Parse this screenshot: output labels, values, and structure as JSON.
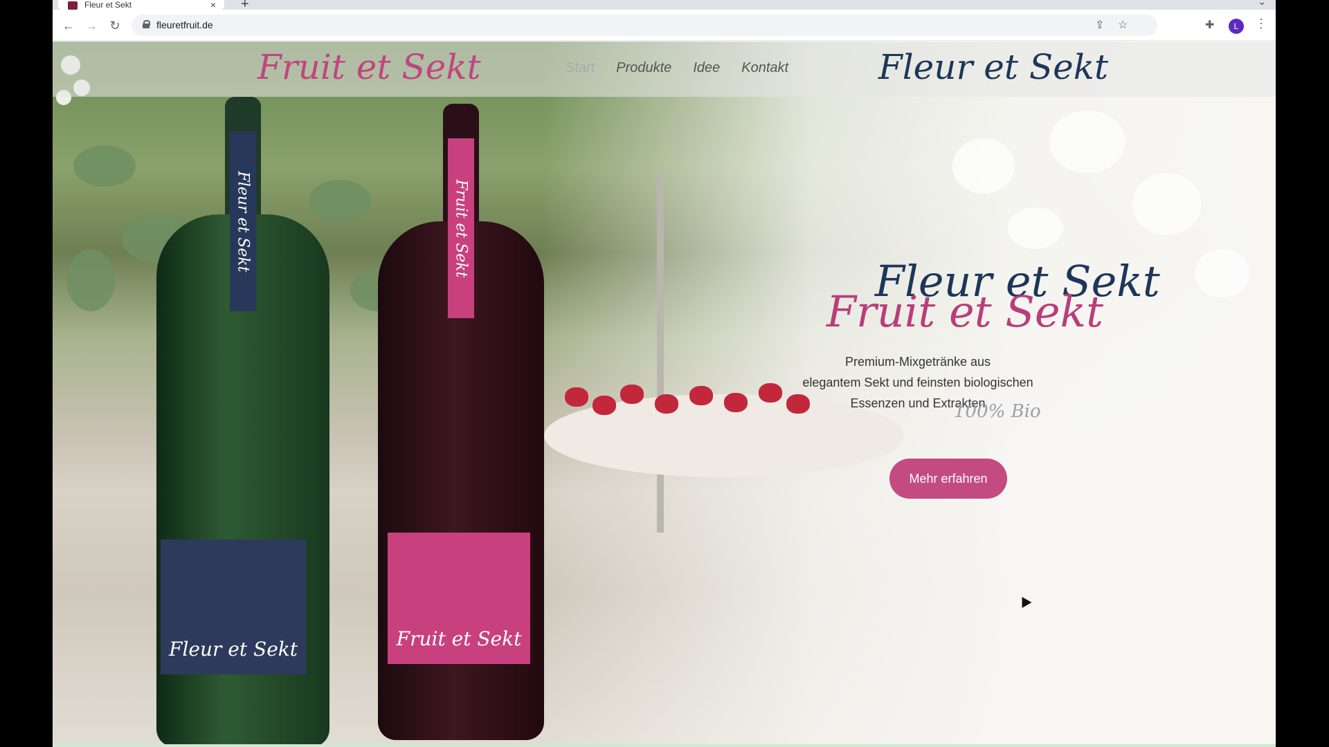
{
  "browser": {
    "tab_title": "Fleur et Sekt",
    "url": "fleuretfruit.de",
    "profile_initial": "L",
    "icons": {
      "back": "arrow-left-icon",
      "forward": "arrow-right-icon",
      "reload": "reload-icon",
      "share": "share-icon",
      "bookmark": "star-icon",
      "extensions": "puzzle-icon",
      "menu": "kebab-menu-icon"
    }
  },
  "site": {
    "logo_left": "Fruit et Sekt",
    "logo_right": "Fleur et Sekt",
    "nav": [
      "Start",
      "Produkte",
      "Idee",
      "Kontakt"
    ],
    "active_nav": "Start"
  },
  "bottles": {
    "left_tag": "Fleur et Sekt",
    "left_label": "Fleur et Sekt",
    "right_tag": "Fruit et Sekt",
    "right_label": "Fruit et Sekt"
  },
  "hero": {
    "title_top": "Fleur et Sekt",
    "title_bottom": "Fruit et Sekt",
    "line1": "Premium-Mixgetränke aus",
    "line2": "elegantem Sekt und feinsten biologischen",
    "line3": "Essenzen und Extrakten",
    "bio_badge": "100% Bio",
    "cta_label": "Mehr erfahren"
  },
  "colors": {
    "brand_pink": "#c44a82",
    "brand_navy": "#1d3659"
  }
}
